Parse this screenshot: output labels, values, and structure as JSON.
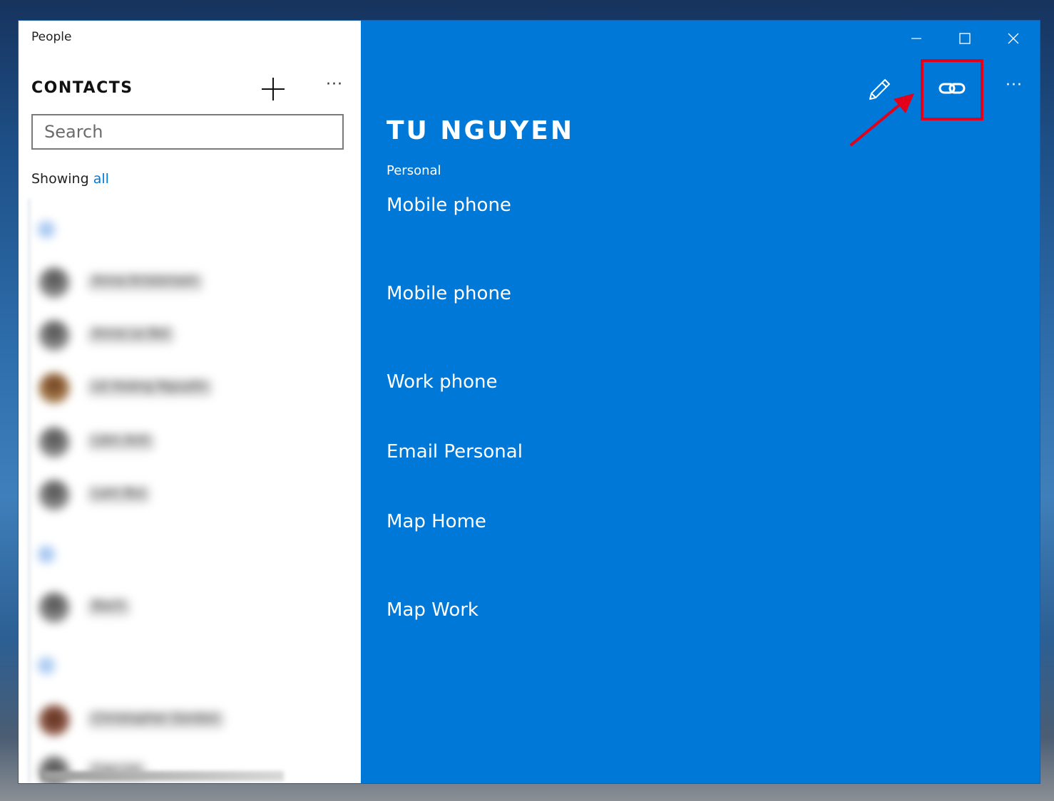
{
  "app": {
    "title": "People"
  },
  "sidebar": {
    "heading": "CONTACTS",
    "search_placeholder": "Search",
    "showing_prefix": "Showing",
    "showing_filter": "all",
    "more_label": "···"
  },
  "contact_list": {
    "groups": [
      {
        "letter": "a",
        "contacts": [
          {
            "name": "Anna Kristensen"
          },
          {
            "name": "Anna Le Bel"
          },
          {
            "name": "Lê Hoàng Nguyên"
          },
          {
            "name": "Lâm Anh"
          },
          {
            "name": "Lam Bui"
          }
        ]
      },
      {
        "letter": "b",
        "contacts": [
          {
            "name": "Bach"
          }
        ]
      },
      {
        "letter": "c",
        "contacts": [
          {
            "name": "Christopher Gordon"
          },
          {
            "name": "Cao Lin"
          }
        ]
      }
    ]
  },
  "contact": {
    "name": "TU NGUYEN",
    "section": "Personal",
    "fields": [
      {
        "label": "Mobile phone"
      },
      {
        "label": "Mobile phone"
      },
      {
        "label": "Work phone"
      },
      {
        "label": "Email Personal"
      },
      {
        "label": "Map Home"
      },
      {
        "label": "Map Work"
      }
    ]
  },
  "toolbar": {
    "more_label": "···"
  },
  "colors": {
    "accent": "#0078d7",
    "highlight": "#e3001b",
    "pane_bg": "#ffffff"
  },
  "icons": {
    "add": "plus-icon",
    "edit": "pencil-icon",
    "link": "link-icon",
    "more": "ellipsis-icon",
    "minimize": "minimize-icon",
    "maximize": "maximize-icon",
    "close": "close-icon"
  }
}
